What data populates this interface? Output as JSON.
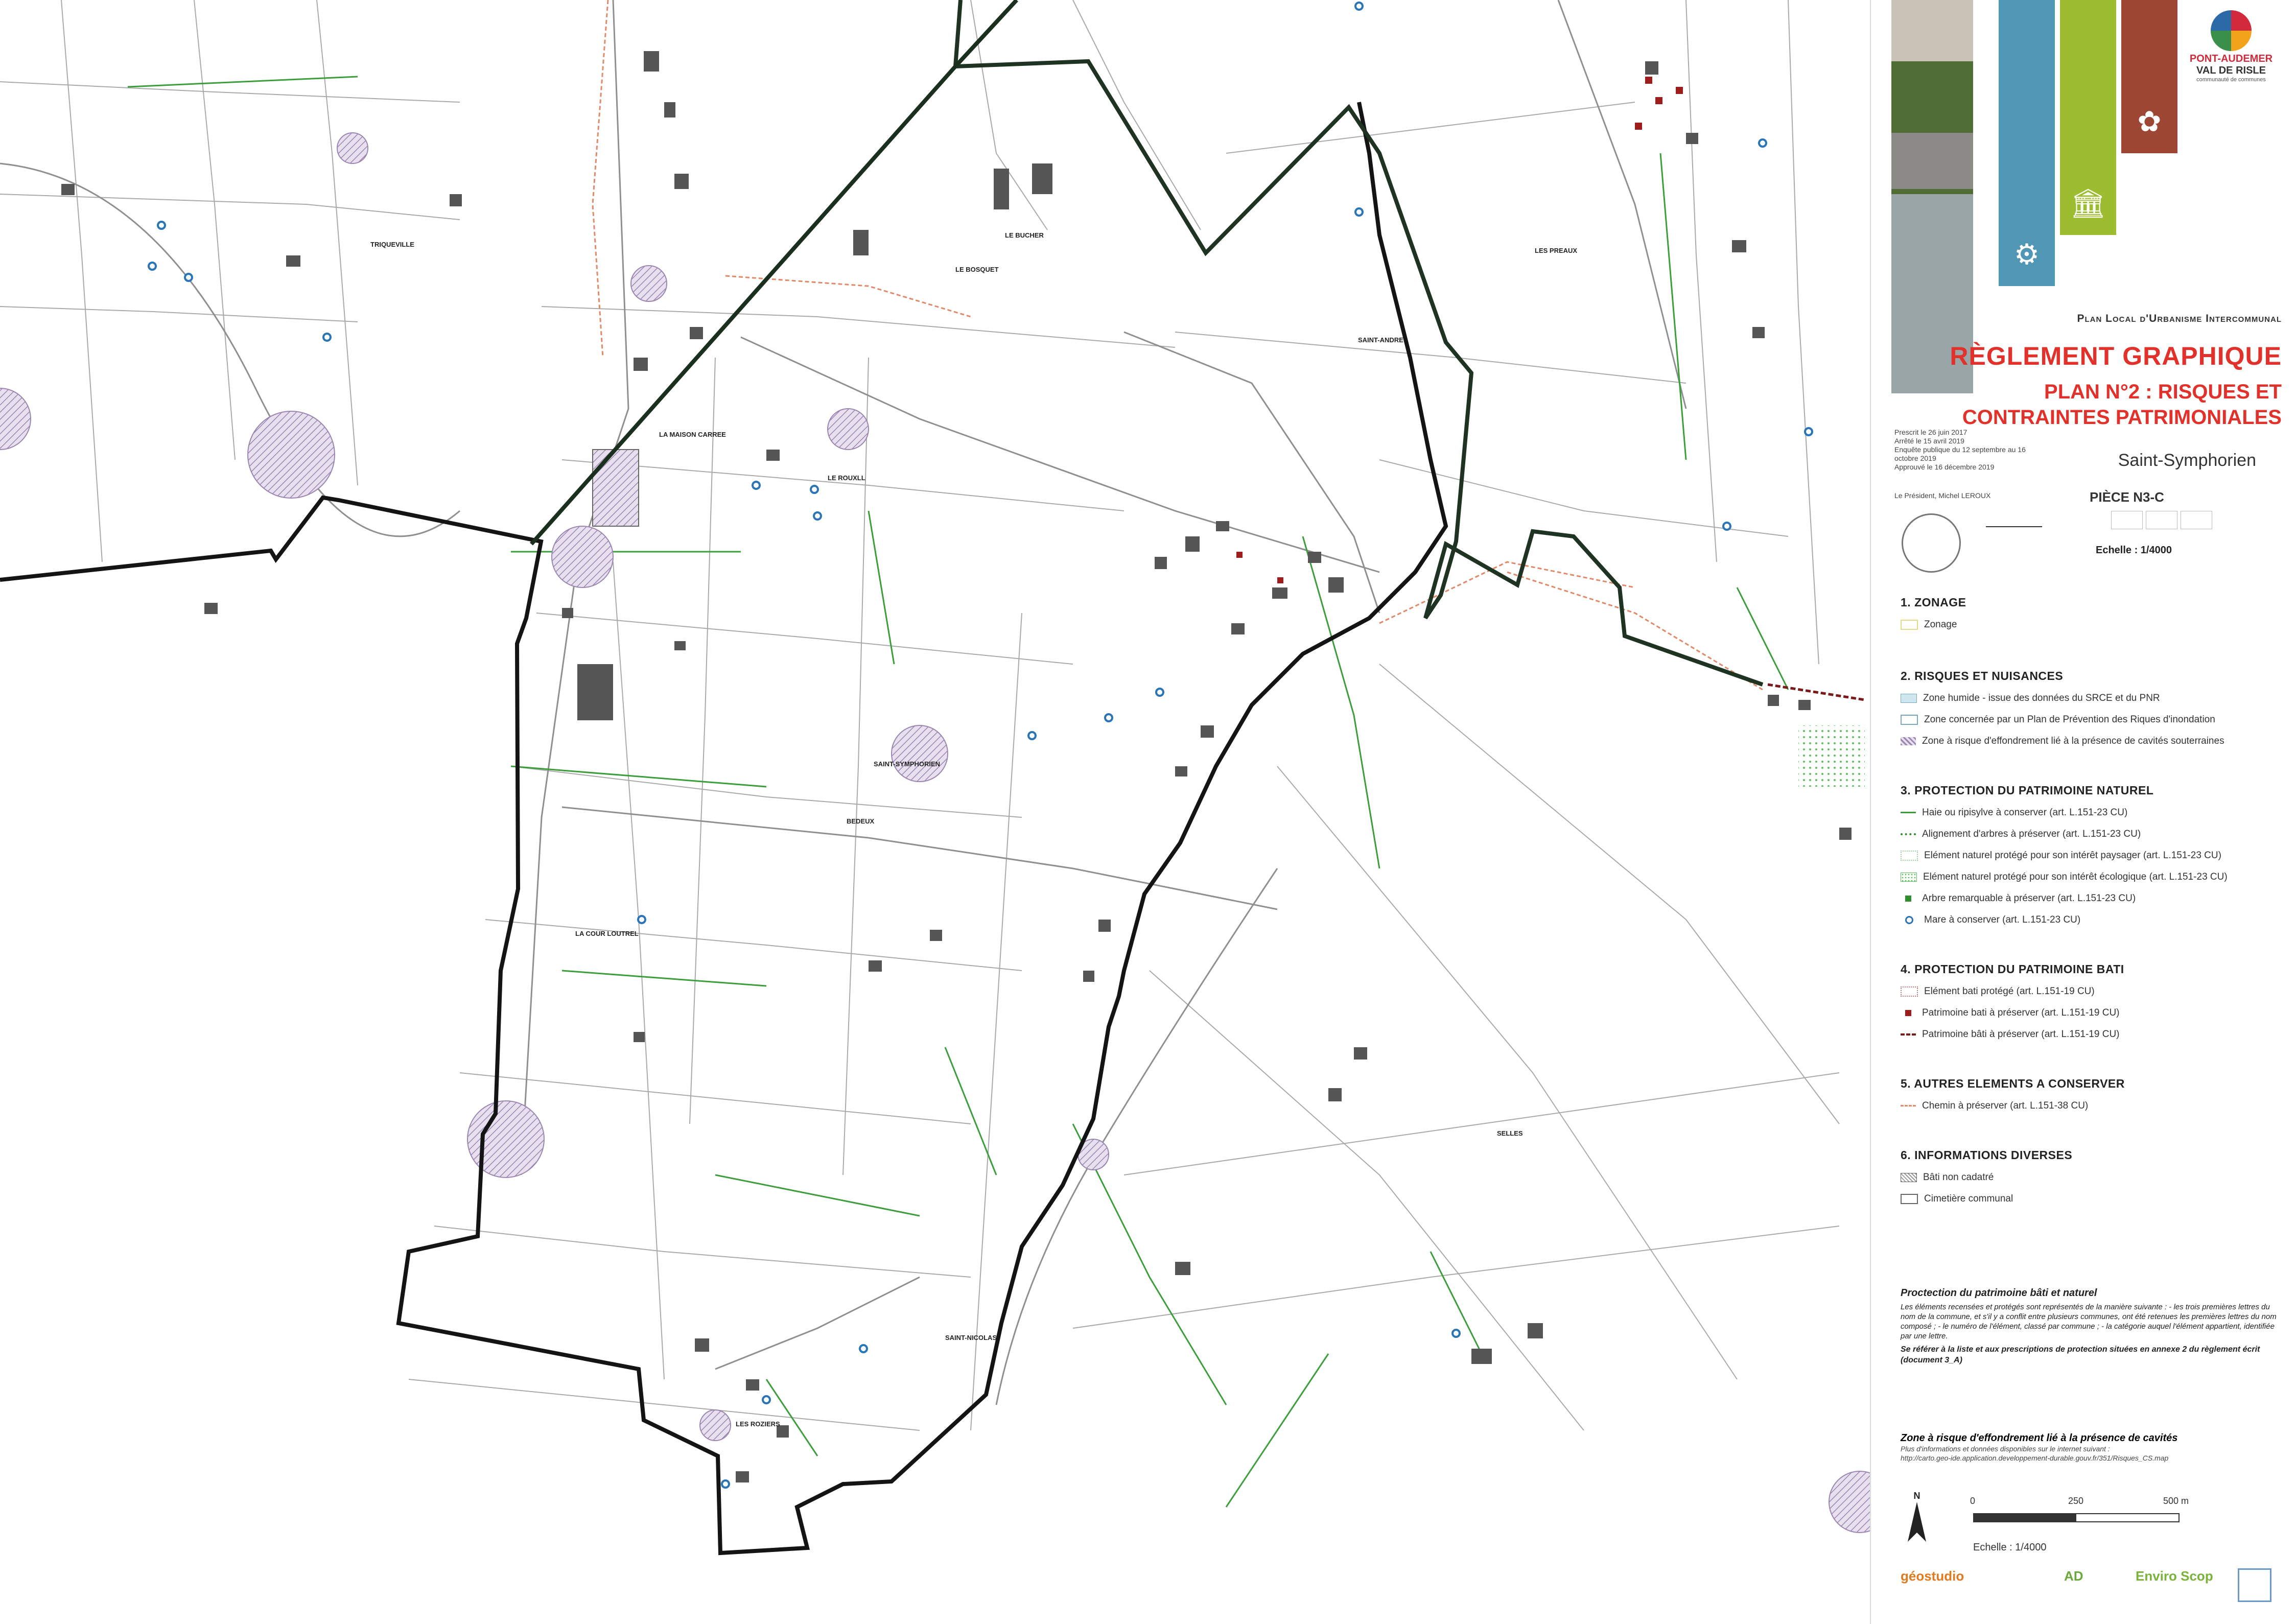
{
  "header": {
    "brand_line1": "PONT-AUDEMER",
    "brand_line2": "VAL DE RISLE",
    "brand_line3": "communauté de communes",
    "plu_title": "Plan Local d'Urbanisme Intercommunal",
    "main_title": "RÈGLEMENT GRAPHIQUE",
    "plan_title_line1": "PLAN N°2 : RISQUES ET",
    "plan_title_line2": "CONTRAINTES PATRIMONIALES",
    "commune": "Saint-Symphorien",
    "dates": "Prescrit le 26 juin 2017\nArrêté le 15 avril 2019\nEnquête publique du 12 septembre au 16 octobre 2019\nApprouvé le 16 décembre 2019",
    "president": "Le Président, Michel LEROUX",
    "piece": "PIÈCE N3-C",
    "echelle": "Echelle : 1/4000"
  },
  "legend": {
    "s1": {
      "title": "1. ZONAGE",
      "items": [
        "Zonage"
      ]
    },
    "s2": {
      "title": "2. RISQUES ET NUISANCES",
      "items": [
        "Zone humide - issue des données du SRCE et du PNR",
        "Zone concernée par un Plan de Prévention des Riques d'inondation",
        "Zone à risque d'effondrement lié à la présence de cavités souterraines"
      ]
    },
    "s3": {
      "title": "3. PROTECTION DU PATRIMOINE NATUREL",
      "items": [
        "Haie ou ripisylve à conserver (art. L.151-23 CU)",
        "Alignement d'arbres à préserver (art. L.151-23 CU)",
        "Elément naturel protégé pour son intérêt paysager (art. L.151-23 CU)",
        "Elément naturel protégé pour son intérêt écologique (art. L.151-23 CU)",
        "Arbre remarquable à préserver (art. L.151-23 CU)",
        "Mare à conserver (art. L.151-23 CU)"
      ]
    },
    "s4": {
      "title": "4. PROTECTION DU PATRIMOINE BATI",
      "items": [
        "Elément bati protégé (art. L.151-19 CU)",
        "Patrimoine bati à préserver (art. L.151-19 CU)",
        "Patrimoine bâti à préserver (art. L.151-19 CU)"
      ]
    },
    "s5": {
      "title": "5. AUTRES ELEMENTS A CONSERVER",
      "items": [
        "Chemin à préserver  (art. L.151-38 CU)"
      ]
    },
    "s6": {
      "title": "6. INFORMATIONS DIVERSES",
      "items": [
        "Bâti non cadatré",
        "Cimetière communal"
      ]
    }
  },
  "notes": {
    "title": "Proctection du patrimoine bâti et naturel",
    "body": "Les éléments recensées et protégés sont représentés de la manière suivante : - les trois premières lettres du nom de la commune, et s'il y a conflit entre plusieurs communes, ont été retenues les premières lettres du nom composé ; - le numéro de l'élément, classé par commune ; - la catégorie auquel l'élément appartient, identifiée par une lettre.",
    "bold": "Se référer à la liste et aux prescriptions de protection situées en annexe 2 du règlement écrit (document 3_A)"
  },
  "cavites": {
    "title": "Zone à risque d'effondrement lié à la présence de cavités",
    "line1": "Plus d'informations et données disponibles sur le internet suivant :",
    "line2": "http://carto.geo-ide.application.developpement-durable.gouv.fr/351/Risques_CS.map"
  },
  "scale": {
    "l0": "0",
    "l1": "250",
    "l2": "500 m",
    "echelle": "Echelle : 1/4000"
  },
  "bottom_logos": [
    "géostudio",
    "AD",
    "Enviro Scop"
  ],
  "map_labels": {
    "triqueville": "TRIQUEVILLE",
    "le_bosquet": "LE BOSQUET",
    "le_bucher": "LE BUCHER",
    "les_preaux": "LES PREAUX",
    "la_maison_carree": "LA MAISON CARREE",
    "le_rouxll": "LE ROUXLL",
    "saint_symphorien": "SAINT-SYMPHORIEN",
    "bedeux": "BEDEUX",
    "la_cour_loutrel": "LA COUR LOUTREL",
    "selles": "SELLES",
    "saint_nicolas": "SAINT-NICOLAS",
    "les_roziers": "LES ROZIERS",
    "saint_andre": "SAINT-ANDRE"
  },
  "colors": {
    "boundary": "#1a1a1a",
    "commune_boundary": "#1f3322",
    "hedge": "#3b9e3b",
    "mare": "#2a74b8",
    "cavity": "#b4a3c6",
    "patrimoine": "#9d1c1c",
    "chemin": "#e08a6a",
    "title_red": "#e2312a"
  },
  "icons": [
    "brain-icon",
    "building-icon",
    "plant-icon",
    "north-arrow-icon"
  ]
}
